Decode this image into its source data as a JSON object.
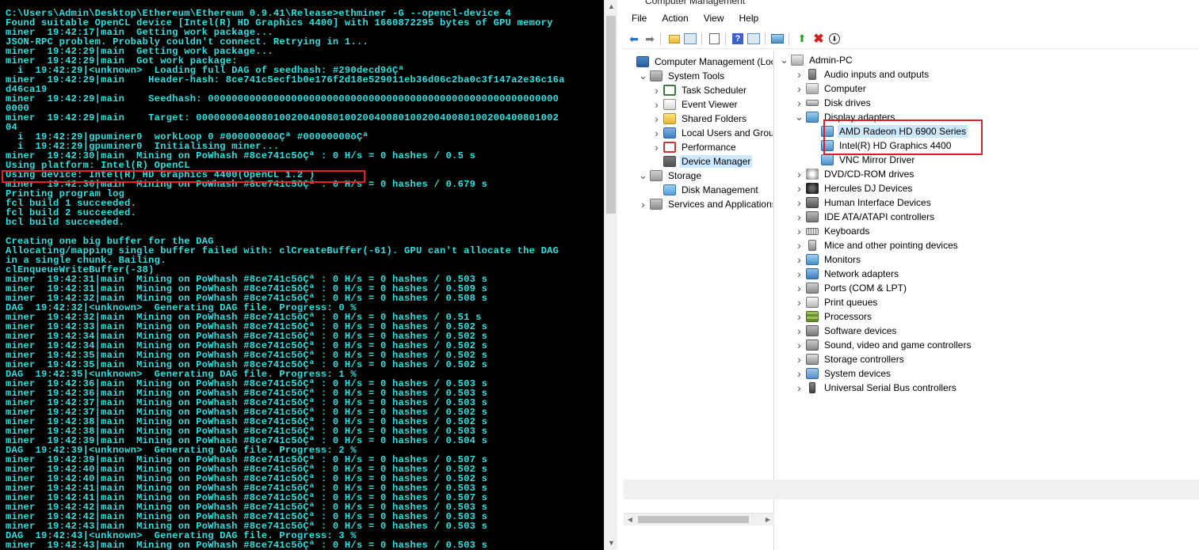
{
  "terminal": {
    "lines": [
      "C:\\Users\\Admin\\Desktop\\Ethereum\\Ethereum 0.9.41\\Release>ethminer -G --opencl-device 4",
      "Found suitable OpenCL device [Intel(R) HD Graphics 4400] with 1660872295 bytes of GPU memory",
      "miner  19:42:17|main  Getting work package...",
      "JSON-RPC problem. Probably couldn't connect. Retrying in 1...",
      "miner  19:42:29|main  Getting work package...",
      "miner  19:42:29|main  Got work package:",
      "  i  19:42:29|<unknown>  Loading full DAG of seedhash: #290decd9ōÇª",
      "miner  19:42:29|main    Header-hash: 8ce741c5ecf1b0e176f2d18e529011eb36d06c2ba0c3f147a2e36c16a",
      "d46ca19",
      "miner  19:42:29|main    Seedhash: 00000000000000000000000000000000000000000000000000000000000",
      "0000",
      "miner  19:42:29|main    Target: 0000000040080100200400801002004008010020040080100200400801002",
      "04",
      "  i  19:42:29|gpuminer0  workLoop 0 #00000000ōÇª #00000000ōÇª",
      "  i  19:42:29|gpuminer0  Initialising miner...",
      "miner  19:42:30|main  Mining on PoWhash #8ce741c5ōÇª : 0 H/s = 0 hashes / 0.5 s",
      "Using platform: Intel(R) OpenCL",
      "Using device: Intel(R) HD Graphics 4400(OpenCL 1.2 )",
      "miner  19:42:30|main  Mining on PoWhash #8ce741c5ōÇª : 0 H/s = 0 hashes / 0.679 s",
      "Printing program log",
      "fcl build 1 succeeded.",
      "fcl build 2 succeeded.",
      "bcl build succeeded.",
      "",
      "Creating one big buffer for the DAG",
      "Allocating/mapping single buffer failed with: clCreateBuffer(-61). GPU can't allocate the DAG",
      "in a single chunk. Bailing.",
      "clEnqueueWriteBuffer(-38)",
      "miner  19:42:31|main  Mining on PoWhash #8ce741c5ōÇª : 0 H/s = 0 hashes / 0.503 s",
      "miner  19:42:31|main  Mining on PoWhash #8ce741c5ōÇª : 0 H/s = 0 hashes / 0.509 s",
      "miner  19:42:32|main  Mining on PoWhash #8ce741c5ōÇª : 0 H/s = 0 hashes / 0.508 s",
      "DAG  19:42:32|<unknown>  Generating DAG file. Progress: 0 %",
      "miner  19:42:32|main  Mining on PoWhash #8ce741c5ōÇª : 0 H/s = 0 hashes / 0.51 s",
      "miner  19:42:33|main  Mining on PoWhash #8ce741c5ōÇª : 0 H/s = 0 hashes / 0.502 s",
      "miner  19:42:34|main  Mining on PoWhash #8ce741c5ōÇª : 0 H/s = 0 hashes / 0.502 s",
      "miner  19:42:34|main  Mining on PoWhash #8ce741c5ōÇª : 0 H/s = 0 hashes / 0.502 s",
      "miner  19:42:35|main  Mining on PoWhash #8ce741c5ōÇª : 0 H/s = 0 hashes / 0.502 s",
      "miner  19:42:35|main  Mining on PoWhash #8ce741c5ōÇª : 0 H/s = 0 hashes / 0.502 s",
      "DAG  19:42:35|<unknown>  Generating DAG file. Progress: 1 %",
      "miner  19:42:36|main  Mining on PoWhash #8ce741c5ōÇª : 0 H/s = 0 hashes / 0.503 s",
      "miner  19:42:36|main  Mining on PoWhash #8ce741c5ōÇª : 0 H/s = 0 hashes / 0.503 s",
      "miner  19:42:37|main  Mining on PoWhash #8ce741c5ōÇª : 0 H/s = 0 hashes / 0.503 s",
      "miner  19:42:37|main  Mining on PoWhash #8ce741c5ōÇª : 0 H/s = 0 hashes / 0.502 s",
      "miner  19:42:38|main  Mining on PoWhash #8ce741c5ōÇª : 0 H/s = 0 hashes / 0.502 s",
      "miner  19:42:38|main  Mining on PoWhash #8ce741c5ōÇª : 0 H/s = 0 hashes / 0.503 s",
      "miner  19:42:39|main  Mining on PoWhash #8ce741c5ōÇª : 0 H/s = 0 hashes / 0.504 s",
      "DAG  19:42:39|<unknown>  Generating DAG file. Progress: 2 %",
      "miner  19:42:39|main  Mining on PoWhash #8ce741c5ōÇª : 0 H/s = 0 hashes / 0.507 s",
      "miner  19:42:40|main  Mining on PoWhash #8ce741c5ōÇª : 0 H/s = 0 hashes / 0.502 s",
      "miner  19:42:40|main  Mining on PoWhash #8ce741c5ōÇª : 0 H/s = 0 hashes / 0.502 s",
      "miner  19:42:41|main  Mining on PoWhash #8ce741c5ōÇª : 0 H/s = 0 hashes / 0.503 s",
      "miner  19:42:41|main  Mining on PoWhash #8ce741c5ōÇª : 0 H/s = 0 hashes / 0.507 s",
      "miner  19:42:42|main  Mining on PoWhash #8ce741c5ōÇª : 0 H/s = 0 hashes / 0.503 s",
      "miner  19:42:42|main  Mining on PoWhash #8ce741c5ōÇª : 0 H/s = 0 hashes / 0.503 s",
      "miner  19:42:43|main  Mining on PoWhash #8ce741c5ōÇª : 0 H/s = 0 hashes / 0.503 s",
      "DAG  19:42:43|<unknown>  Generating DAG file. Progress: 3 %",
      "miner  19:42:43|main  Mining on PoWhash #8ce741c5ōÇª : 0 H/s = 0 hashes / 0.503 s"
    ],
    "text_color": "#2ee0e0",
    "highlight_color": "#e02424"
  },
  "computer_management": {
    "title": "Computer Management",
    "menu": [
      "File",
      "Action",
      "View",
      "Help"
    ],
    "toolbar_icons": [
      "back-arrow-icon",
      "forward-arrow-icon",
      "up-folder-icon",
      "show-hide-tree-icon",
      "properties-icon",
      "help-icon",
      "show-hide-action-pane-icon",
      "monitor-icon",
      "update-driver-icon",
      "uninstall-icon",
      "scan-hardware-icon"
    ],
    "left_tree": [
      {
        "label": "Computer Management (Local",
        "icon": "computer-management-icon",
        "exp": "",
        "level": 0
      },
      {
        "label": "System Tools",
        "icon": "system-tools-icon",
        "exp": "v",
        "level": 1
      },
      {
        "label": "Task Scheduler",
        "icon": "task-scheduler-icon",
        "exp": ">",
        "level": 2
      },
      {
        "label": "Event Viewer",
        "icon": "event-viewer-icon",
        "exp": ">",
        "level": 2
      },
      {
        "label": "Shared Folders",
        "icon": "shared-folders-icon",
        "exp": ">",
        "level": 2
      },
      {
        "label": "Local Users and Groups",
        "icon": "local-users-icon",
        "exp": ">",
        "level": 2
      },
      {
        "label": "Performance",
        "icon": "performance-icon",
        "exp": ">",
        "level": 2
      },
      {
        "label": "Device Manager",
        "icon": "device-manager-icon",
        "exp": "",
        "level": 2,
        "selected": true
      },
      {
        "label": "Storage",
        "icon": "storage-icon",
        "exp": "v",
        "level": 1
      },
      {
        "label": "Disk Management",
        "icon": "disk-management-icon",
        "exp": "",
        "level": 2
      },
      {
        "label": "Services and Applications",
        "icon": "services-icon",
        "exp": ">",
        "level": 1
      }
    ],
    "right_tree": [
      {
        "label": "Admin-PC",
        "icon": "computer-icon",
        "exp": "v",
        "level": 0
      },
      {
        "label": "Audio inputs and outputs",
        "icon": "audio-icon",
        "exp": ">",
        "level": 1
      },
      {
        "label": "Computer",
        "icon": "computer-icon",
        "exp": ">",
        "level": 1
      },
      {
        "label": "Disk drives",
        "icon": "disk-drive-icon",
        "exp": ">",
        "level": 1
      },
      {
        "label": "Display adapters",
        "icon": "display-adapter-icon",
        "exp": "v",
        "level": 1
      },
      {
        "label": "AMD Radeon HD 6900 Series",
        "icon": "display-adapter-icon",
        "exp": "",
        "level": 2,
        "selected": true
      },
      {
        "label": "Intel(R) HD Graphics 4400",
        "icon": "display-adapter-icon",
        "exp": "",
        "level": 2
      },
      {
        "label": "VNC Mirror Driver",
        "icon": "display-adapter-icon",
        "exp": "",
        "level": 2
      },
      {
        "label": "DVD/CD-ROM drives",
        "icon": "dvd-icon",
        "exp": ">",
        "level": 1
      },
      {
        "label": "Hercules DJ Devices",
        "icon": "hercules-icon",
        "exp": ">",
        "level": 1
      },
      {
        "label": "Human Interface Devices",
        "icon": "hid-icon",
        "exp": ">",
        "level": 1
      },
      {
        "label": "IDE ATA/ATAPI controllers",
        "icon": "ide-controller-icon",
        "exp": ">",
        "level": 1
      },
      {
        "label": "Keyboards",
        "icon": "keyboard-icon",
        "exp": ">",
        "level": 1
      },
      {
        "label": "Mice and other pointing devices",
        "icon": "mouse-icon",
        "exp": ">",
        "level": 1
      },
      {
        "label": "Monitors",
        "icon": "monitor-icon",
        "exp": ">",
        "level": 1
      },
      {
        "label": "Network adapters",
        "icon": "network-adapter-icon",
        "exp": ">",
        "level": 1
      },
      {
        "label": "Ports (COM & LPT)",
        "icon": "port-icon",
        "exp": ">",
        "level": 1
      },
      {
        "label": "Print queues",
        "icon": "printer-icon",
        "exp": ">",
        "level": 1
      },
      {
        "label": "Processors",
        "icon": "processor-icon",
        "exp": ">",
        "level": 1
      },
      {
        "label": "Software devices",
        "icon": "software-device-icon",
        "exp": ">",
        "level": 1
      },
      {
        "label": "Sound, video and game controllers",
        "icon": "sound-icon",
        "exp": ">",
        "level": 1
      },
      {
        "label": "Storage controllers",
        "icon": "storage-controller-icon",
        "exp": ">",
        "level": 1
      },
      {
        "label": "System devices",
        "icon": "system-device-icon",
        "exp": ">",
        "level": 1
      },
      {
        "label": "Universal Serial Bus controllers",
        "icon": "usb-icon",
        "exp": ">",
        "level": 1
      }
    ],
    "highlight_color": "#d8202a"
  }
}
